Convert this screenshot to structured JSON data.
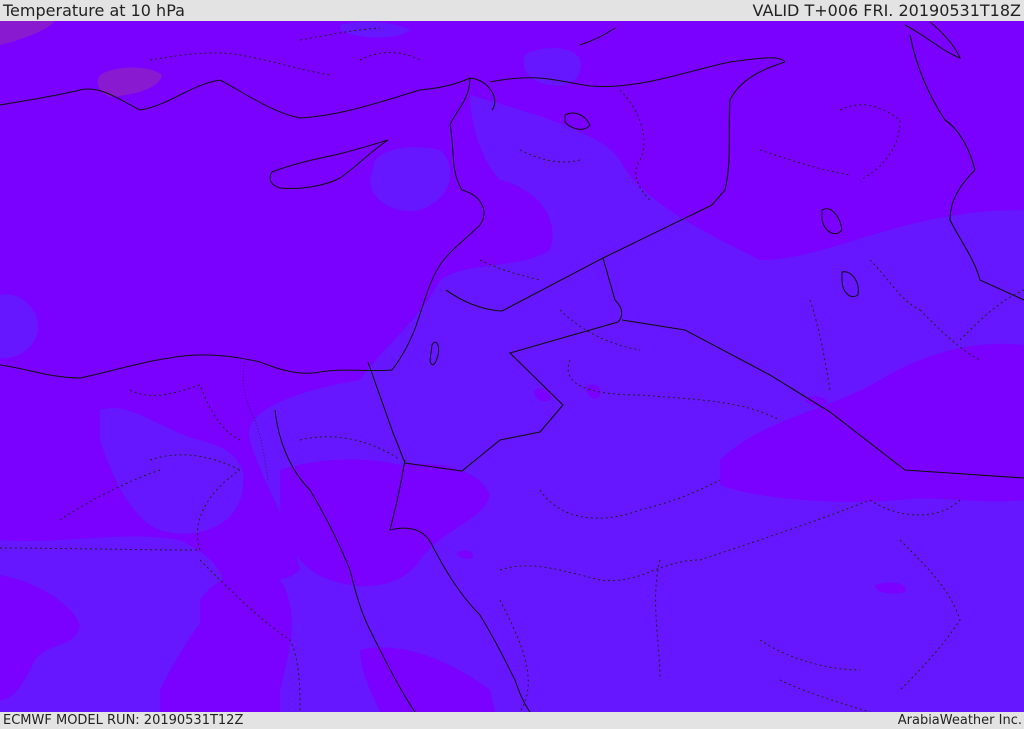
{
  "header": {
    "title": "Temperature at 10 hPa",
    "valid": "VALID T+006 FRI. 20190531T18Z"
  },
  "footer": {
    "model_run": "ECMWF MODEL RUN: 20190531T12Z",
    "credit": "ArabiaWeather Inc."
  },
  "colors": {
    "warm_band": "#7a00ff",
    "cool_band": "#6617ff",
    "coldest_patch": "#6a10d8",
    "warmest_patch": "#8a1ad0",
    "borders": "#111111"
  }
}
